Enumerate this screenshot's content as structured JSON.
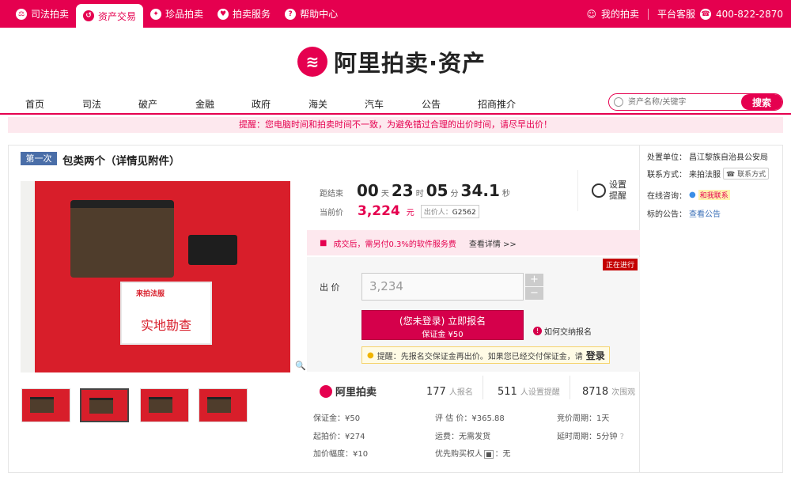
{
  "topbar": {
    "nav": [
      {
        "label": "司法拍卖",
        "icon": "gavel-icon",
        "glyph": "⚖"
      },
      {
        "label": "资产交易",
        "icon": "asset-icon",
        "glyph": "↺",
        "active": true
      },
      {
        "label": "珍品拍卖",
        "icon": "treasure-icon",
        "glyph": "✦"
      },
      {
        "label": "拍卖服务",
        "icon": "heart-icon",
        "glyph": "♥"
      },
      {
        "label": "帮助中心",
        "icon": "help-icon",
        "glyph": "?"
      }
    ],
    "my_auction": "我的拍卖",
    "service_label": "平台客服",
    "phone": "400-822-2870"
  },
  "header": {
    "logo_text": "阿里拍卖·资产",
    "logo_glyph": "≋"
  },
  "mainnav": {
    "items": [
      "首页",
      "司法",
      "破产",
      "金融",
      "政府",
      "海关",
      "汽车",
      "公告",
      "招商推介"
    ],
    "search_placeholder": "资产名称/关键字",
    "search_button": "搜索"
  },
  "warning": "提醒：您电脑时间和拍卖时间不一致，为避免错过合理的出价时间，请尽早出价！",
  "item": {
    "round_badge": "第一次",
    "title": "包类两个（详情见附件）",
    "sign_logo": "来拍法服",
    "sign_text": "实地勘查",
    "zoom_glyph": "🔍"
  },
  "countdown": {
    "label": "距结束",
    "days": "00",
    "days_unit": "天",
    "hours": "23",
    "hours_unit": "时",
    "minutes": "05",
    "minutes_unit": "分",
    "seconds": "34.1",
    "seconds_unit": "秒"
  },
  "price": {
    "label": "当前价",
    "value": "3,224",
    "unit": "元",
    "bidder_label": "出价人：",
    "bidder": "G2562"
  },
  "remind": {
    "line1": "设置",
    "line2": "提醒"
  },
  "fee": {
    "text": "成交后，需另付0.3%的软件服务费",
    "link": "查看详情 >>"
  },
  "status_badge": "正在进行",
  "bid": {
    "label": "出 价",
    "value": "3,234",
    "plus": "+",
    "minus": "−",
    "register_line1": "(您未登录) 立即报名",
    "register_line2": "保证金 ¥50",
    "how_register": "如何交纳报名",
    "tip": "提醒：先报名交保证金再出价。如果您已经交付保证金，请",
    "tip_link": "登录"
  },
  "stats": {
    "logo": "阿里拍卖",
    "signups": "177",
    "signups_label": "人报名",
    "reminders": "511",
    "reminders_label": "人设置提醒",
    "views": "8718",
    "views_label": "次围观"
  },
  "details": {
    "deposit": "保证金：¥50",
    "start_price": "起拍价：¥274",
    "increment": "加价幅度：¥10",
    "appraisal": "评 估 价：¥365.88",
    "shipping": "运费：无需发货",
    "priority_label": "优先购买权人",
    "priority_value": "：无",
    "cycle": "竞价周期：1天",
    "delay": "延时周期：5分钟"
  },
  "sidebar": {
    "unit_label": "处置单位：",
    "unit": "昌江黎族自治县公安局",
    "contact_label": "联系方式：",
    "contact": "来拍法服",
    "contact_btn": "联系方式",
    "chat_label": "在线咨询：",
    "chat_btn": "和我联系",
    "notice_label": "标的公告：",
    "notice_link": "查看公告"
  },
  "colors": {
    "brand": "#e5004f",
    "item_red": "#d81e2a"
  }
}
